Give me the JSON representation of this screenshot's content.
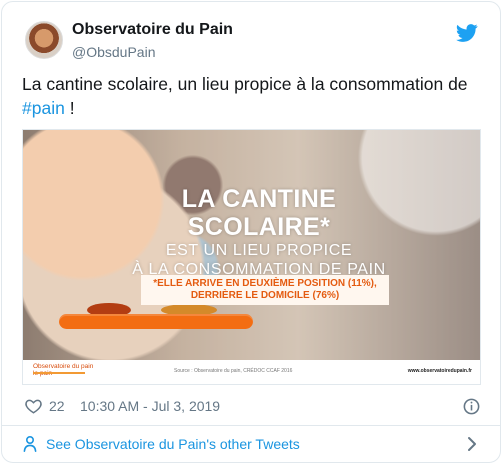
{
  "account": {
    "display_name": "Observatoire du Pain",
    "handle": "@ObsduPain",
    "avatar_icon": "bread-avatar-icon",
    "logo_icon": "twitter-bird-icon"
  },
  "tweet": {
    "text_before": "La cantine scolaire, un lieu propice à la consommation de ",
    "hashtag": "#pain",
    "text_after": " !"
  },
  "media": {
    "headline_1": "LA CANTINE SCOLAIRE*",
    "headline_2": "EST UN LIEU PROPICE",
    "headline_3": "À LA CONSOMMATION DE PAIN",
    "subtext_1": "*ELLE ARRIVE EN DEUXIÈME POSITION (11%),",
    "subtext_2": "DERRIÈRE LE DOMICILE (76%)",
    "logo_line_1": "Observatoire du pain",
    "logo_line_2": "le pain",
    "source": "Source : Observatoire du pain, CRÉDOC CCAF 2016",
    "site": "www.observatoiredupain.fr"
  },
  "meta": {
    "like_count": "22",
    "timestamp": "10:30 AM - Jul 3, 2019",
    "heart_icon": "heart-icon",
    "info_icon": "info-icon"
  },
  "footer": {
    "see_more": "See Observatoire du Pain's other Tweets",
    "person_icon": "person-icon",
    "chevron_icon": "chevron-right-icon"
  },
  "colors": {
    "link": "#1b95e0",
    "muted": "#657786",
    "text": "#14171a",
    "accent_orange": "#f36d12"
  }
}
